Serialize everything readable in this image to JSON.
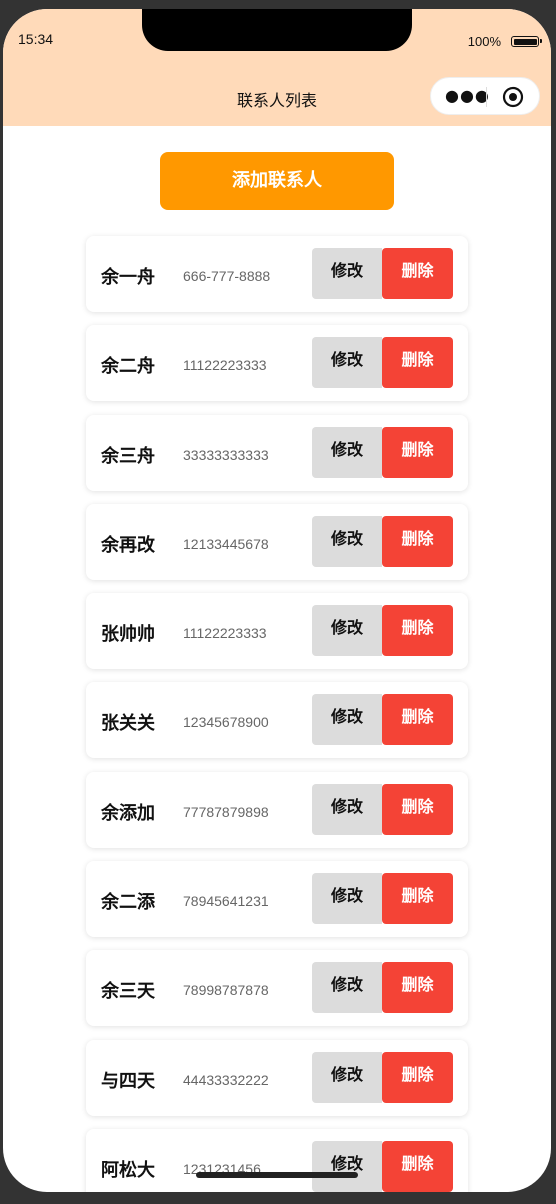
{
  "status_bar": {
    "time": "15:34",
    "battery_text": "100%"
  },
  "nav": {
    "title": "联系人列表",
    "more_icon": "more-dots-icon",
    "close_icon": "target-circle-icon"
  },
  "add_button": {
    "label": "添加联系人"
  },
  "contacts": [
    {
      "name": "余一舟",
      "phone": "666-777-8888"
    },
    {
      "name": "余二舟",
      "phone": "11122223333"
    },
    {
      "name": "余三舟",
      "phone": "33333333333"
    },
    {
      "name": "余再改",
      "phone": "12133445678"
    },
    {
      "name": "张帅帅",
      "phone": "11122223333"
    },
    {
      "name": "张关关",
      "phone": "12345678900"
    },
    {
      "name": "余添加",
      "phone": "77787879898"
    },
    {
      "name": "余二添",
      "phone": "78945641231"
    },
    {
      "name": "余三天",
      "phone": "78998787878"
    },
    {
      "name": "与四天",
      "phone": "44433332222"
    },
    {
      "name": "阿松大",
      "phone": "1231231456"
    }
  ],
  "row_actions": {
    "edit_label": "修改",
    "delete_label": "删除"
  },
  "colors": {
    "header_bg": "#FFDAB9",
    "add_button": "#FF9800",
    "edit_button": "#DCDCDC",
    "delete_button": "#F44336"
  }
}
